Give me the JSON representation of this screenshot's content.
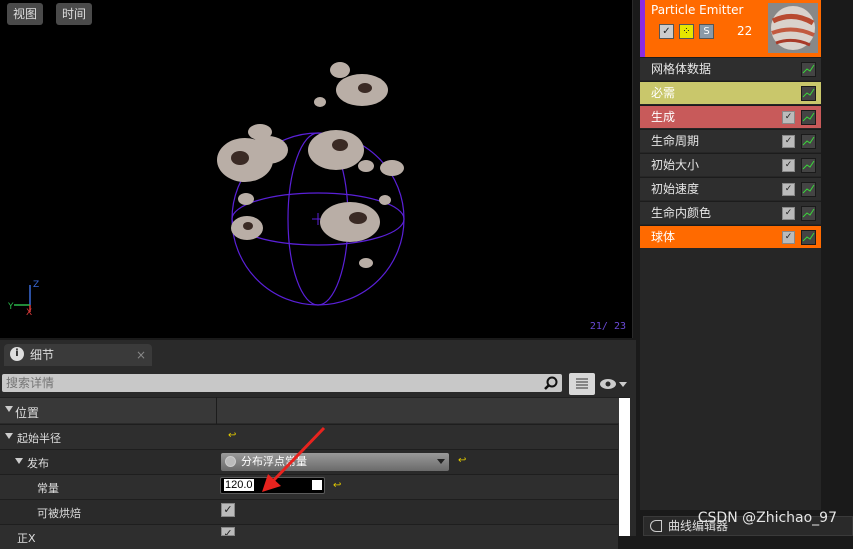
{
  "viewport": {
    "view_button": "视图",
    "time_button": "时间",
    "frame_counter": "21/ 23",
    "axes": {
      "x": "X",
      "y": "Y",
      "z": "Z"
    }
  },
  "emitter": {
    "title": "Particle Emitter",
    "count": "22",
    "modules": [
      {
        "label": "网格体数据",
        "has_checkbox": false
      },
      {
        "label": "必需",
        "has_checkbox": false
      },
      {
        "label": "生成",
        "has_checkbox": true
      },
      {
        "label": "生命周期",
        "has_checkbox": true
      },
      {
        "label": "初始大小",
        "has_checkbox": true
      },
      {
        "label": "初始速度",
        "has_checkbox": true
      },
      {
        "label": "生命内颜色",
        "has_checkbox": true
      },
      {
        "label": "球体",
        "has_checkbox": true
      }
    ]
  },
  "curve_editor": {
    "label": "曲线编辑器"
  },
  "watermark": "CSDN @Zhichao_97",
  "details": {
    "tab_label": "细节",
    "tab_close": "×",
    "info_icon": "i",
    "search_placeholder": "搜索详情",
    "section_position": "位置",
    "start_radius": "起始半径",
    "distribution": "发布",
    "distribution_value": "分布浮点常量",
    "constant": "常量",
    "constant_value": "120.0",
    "can_be_baked": "可被烘焙",
    "positive_x": "正X",
    "reset_glyph": "↩"
  },
  "colors": {
    "emitter_header": "#ff6a00",
    "required_row": "#c9c76b",
    "spawn_row": "#c85a5a",
    "sphere_row": "#ff6a00",
    "annotation_arrow": "#e8231e"
  }
}
